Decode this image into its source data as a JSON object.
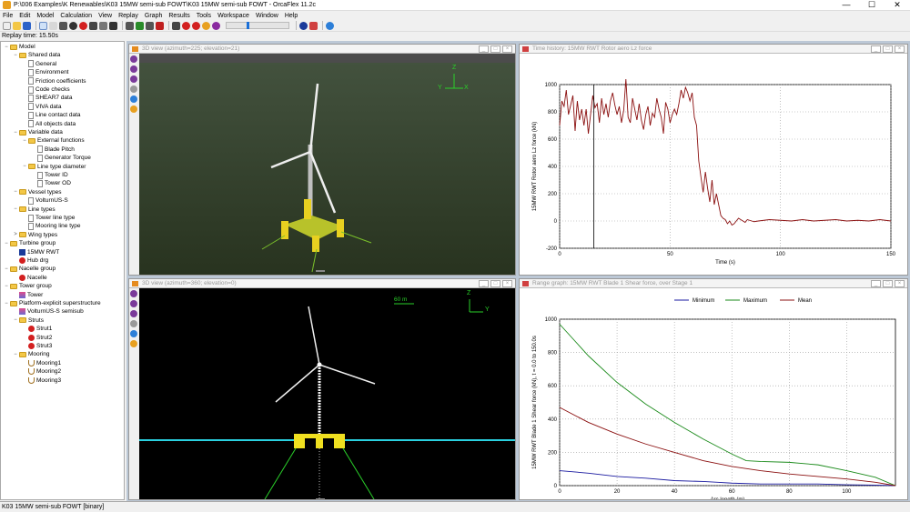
{
  "titlebar": {
    "title": "P:\\006 Examples\\K Renewables\\K03 15MW semi-sub FOWT\\K03 15MW semi-sub FOWT - OrcaFlex 11.2c",
    "min": "—",
    "max": "☐",
    "close": "✕"
  },
  "menu": [
    "File",
    "Edit",
    "Model",
    "Calculation",
    "View",
    "Replay",
    "Graph",
    "Results",
    "Tools",
    "Workspace",
    "Window",
    "Help"
  ],
  "replay_time": "Replay time: 15.50s",
  "tree": [
    {
      "label": "Model",
      "level": 0,
      "exp": "−",
      "icon": "folder"
    },
    {
      "label": "Shared data",
      "level": 1,
      "exp": "−",
      "icon": "folder"
    },
    {
      "label": "General",
      "level": 2,
      "exp": "",
      "icon": "page"
    },
    {
      "label": "Environment",
      "level": 2,
      "exp": "",
      "icon": "page"
    },
    {
      "label": "Friction coefficients",
      "level": 2,
      "exp": "",
      "icon": "page"
    },
    {
      "label": "Code checks",
      "level": 2,
      "exp": "",
      "icon": "page"
    },
    {
      "label": "SHEAR7 data",
      "level": 2,
      "exp": "",
      "icon": "page"
    },
    {
      "label": "VIVA data",
      "level": 2,
      "exp": "",
      "icon": "page"
    },
    {
      "label": "Line contact data",
      "level": 2,
      "exp": "",
      "icon": "page"
    },
    {
      "label": "All objects data",
      "level": 2,
      "exp": "",
      "icon": "page"
    },
    {
      "label": "Variable data",
      "level": 1,
      "exp": "−",
      "icon": "folder"
    },
    {
      "label": "External functions",
      "level": 2,
      "exp": "−",
      "icon": "folder"
    },
    {
      "label": "Blade Pitch",
      "level": 3,
      "exp": "",
      "icon": "page"
    },
    {
      "label": "Generator Torque",
      "level": 3,
      "exp": "",
      "icon": "page"
    },
    {
      "label": "Line type diameter",
      "level": 2,
      "exp": "−",
      "icon": "folder"
    },
    {
      "label": "Tower ID",
      "level": 3,
      "exp": "",
      "icon": "page"
    },
    {
      "label": "Tower OD",
      "level": 3,
      "exp": "",
      "icon": "page"
    },
    {
      "label": "Vessel types",
      "level": 1,
      "exp": "−",
      "icon": "folder"
    },
    {
      "label": "VolturnUS-S",
      "level": 2,
      "exp": "",
      "icon": "page"
    },
    {
      "label": "Line types",
      "level": 1,
      "exp": "−",
      "icon": "folder"
    },
    {
      "label": "Tower line type",
      "level": 2,
      "exp": "",
      "icon": "page"
    },
    {
      "label": "Mooring line type",
      "level": 2,
      "exp": "",
      "icon": "page"
    },
    {
      "label": "Wing types",
      "level": 1,
      "exp": ">",
      "icon": "folder"
    },
    {
      "label": "Turbine group",
      "level": 0,
      "exp": "−",
      "icon": "folder"
    },
    {
      "label": "15MW RWT",
      "level": 1,
      "exp": "",
      "icon": "turbine"
    },
    {
      "label": "Hub drg",
      "level": 1,
      "exp": "",
      "icon": "buoy"
    },
    {
      "label": "Nacelle group",
      "level": 0,
      "exp": "−",
      "icon": "folder"
    },
    {
      "label": "Nacelle",
      "level": 1,
      "exp": "",
      "icon": "buoy"
    },
    {
      "label": "Tower group",
      "level": 0,
      "exp": "−",
      "icon": "folder"
    },
    {
      "label": "Tower",
      "level": 1,
      "exp": "",
      "icon": "line"
    },
    {
      "label": "Platform-explicit superstructure",
      "level": 0,
      "exp": "−",
      "icon": "folder"
    },
    {
      "label": "VolturnUS-S semisub",
      "level": 1,
      "exp": "",
      "icon": "vessel"
    },
    {
      "label": "Struts",
      "level": 1,
      "exp": "−",
      "icon": "folder"
    },
    {
      "label": "Strut1",
      "level": 2,
      "exp": "",
      "icon": "buoy"
    },
    {
      "label": "Strut2",
      "level": 2,
      "exp": "",
      "icon": "buoy"
    },
    {
      "label": "Strut3",
      "level": 2,
      "exp": "",
      "icon": "buoy"
    },
    {
      "label": "Mooring",
      "level": 1,
      "exp": "−",
      "icon": "folder"
    },
    {
      "label": "Mooring1",
      "level": 2,
      "exp": "",
      "icon": "mooring"
    },
    {
      "label": "Mooring2",
      "level": 2,
      "exp": "",
      "icon": "mooring"
    },
    {
      "label": "Mooring3",
      "level": 2,
      "exp": "",
      "icon": "mooring"
    }
  ],
  "status": "K03 15MW semi-sub FOWT [binary]",
  "win_3d_top": {
    "title": "3D view (azimuth=225; elevation=21)",
    "axes": {
      "z": "Z",
      "y": "Y",
      "x": "X"
    }
  },
  "win_3d_bottom": {
    "title": "3D view (azimuth=360; elevation=0)",
    "scale": "60 m",
    "axes": {
      "z": "Z",
      "y": "Y"
    }
  },
  "win_time": {
    "title": "Time history: 15MW RWT Rotor aero Lz force"
  },
  "win_range": {
    "title": "Range graph: 15MW RWT Blade 1 Shear force, over Stage 1"
  },
  "chart_data": [
    {
      "type": "line",
      "title": "",
      "xlabel": "Time (s)",
      "ylabel": "15MW RWT Rotor aero Lz force (kN)",
      "xlim": [
        0,
        150
      ],
      "ylim": [
        -200,
        1000
      ],
      "xticks": [
        0,
        50,
        100,
        150
      ],
      "yticks": [
        -200,
        0,
        200,
        400,
        600,
        800,
        1000
      ],
      "color": "#8b1010",
      "marker_x": 15.5,
      "series": [
        {
          "x": [
            0,
            1,
            2,
            3,
            4,
            5,
            6,
            7,
            8,
            9,
            10,
            11,
            12,
            13,
            14,
            15,
            16,
            17,
            18,
            19,
            20,
            21,
            22,
            23,
            24,
            25,
            26,
            27,
            28,
            29,
            30,
            31,
            32,
            33,
            34,
            35,
            36,
            37,
            38,
            39,
            40,
            41,
            42,
            43,
            44,
            45,
            46,
            47,
            48,
            49,
            50,
            51,
            52,
            53,
            54,
            55,
            56,
            57,
            58,
            59,
            60,
            61,
            62,
            63,
            64,
            65,
            66,
            67,
            68,
            69,
            70,
            71,
            72,
            73,
            74,
            75,
            76,
            77,
            78,
            79,
            80,
            81,
            82,
            83,
            84,
            85,
            86,
            87,
            88,
            90,
            95,
            100,
            105,
            110,
            115,
            120,
            125,
            130,
            135,
            140,
            145,
            150
          ],
          "y": [
            700,
            880,
            840,
            960,
            780,
            850,
            920,
            660,
            880,
            740,
            820,
            700,
            820,
            640,
            780,
            920,
            830,
            860,
            720,
            900,
            780,
            860,
            760,
            880,
            940,
            850,
            780,
            840,
            720,
            810,
            1040,
            760,
            720,
            900,
            820,
            740,
            860,
            740,
            670,
            780,
            840,
            700,
            790,
            760,
            900,
            820,
            760,
            640,
            870,
            820,
            720,
            780,
            820,
            780,
            860,
            960,
            900,
            980,
            940,
            880,
            940,
            760,
            700,
            440,
            320,
            210,
            360,
            240,
            140,
            300,
            120,
            200,
            120,
            40,
            20,
            10,
            -20,
            0,
            -30,
            -20,
            0,
            20,
            10,
            0,
            -10,
            10,
            5,
            0,
            -5,
            0,
            10,
            5,
            0,
            10,
            0,
            5,
            10,
            0,
            5,
            0,
            10,
            0
          ]
        }
      ]
    },
    {
      "type": "line",
      "title": "",
      "xlabel": "Arc length (m)",
      "ylabel": "15MW RWT Blade 1 Shear force (kN), t = 0.0 to 150.0s",
      "xlim": [
        0,
        117
      ],
      "ylim": [
        0,
        1000
      ],
      "xticks": [
        0,
        20,
        40,
        60,
        80,
        100
      ],
      "yticks": [
        0,
        200,
        400,
        600,
        800,
        1000
      ],
      "legend_position": "top",
      "series": [
        {
          "name": "Minimum",
          "color": "#1a1aa0",
          "x": [
            0,
            10,
            20,
            30,
            40,
            50,
            55,
            60,
            70,
            80,
            90,
            100,
            110,
            117
          ],
          "y": [
            90,
            75,
            55,
            45,
            30,
            25,
            20,
            15,
            10,
            10,
            10,
            5,
            3,
            0
          ]
        },
        {
          "name": "Maximum",
          "color": "#1a8a1a",
          "x": [
            0,
            10,
            20,
            30,
            40,
            50,
            60,
            65,
            70,
            80,
            90,
            100,
            110,
            117
          ],
          "y": [
            970,
            780,
            620,
            490,
            380,
            280,
            190,
            150,
            145,
            140,
            125,
            90,
            50,
            0
          ]
        },
        {
          "name": "Mean",
          "color": "#8b1010",
          "x": [
            0,
            10,
            20,
            30,
            40,
            50,
            60,
            70,
            80,
            90,
            100,
            110,
            117
          ],
          "y": [
            470,
            380,
            310,
            250,
            200,
            150,
            115,
            90,
            70,
            55,
            40,
            20,
            0
          ]
        }
      ]
    }
  ]
}
